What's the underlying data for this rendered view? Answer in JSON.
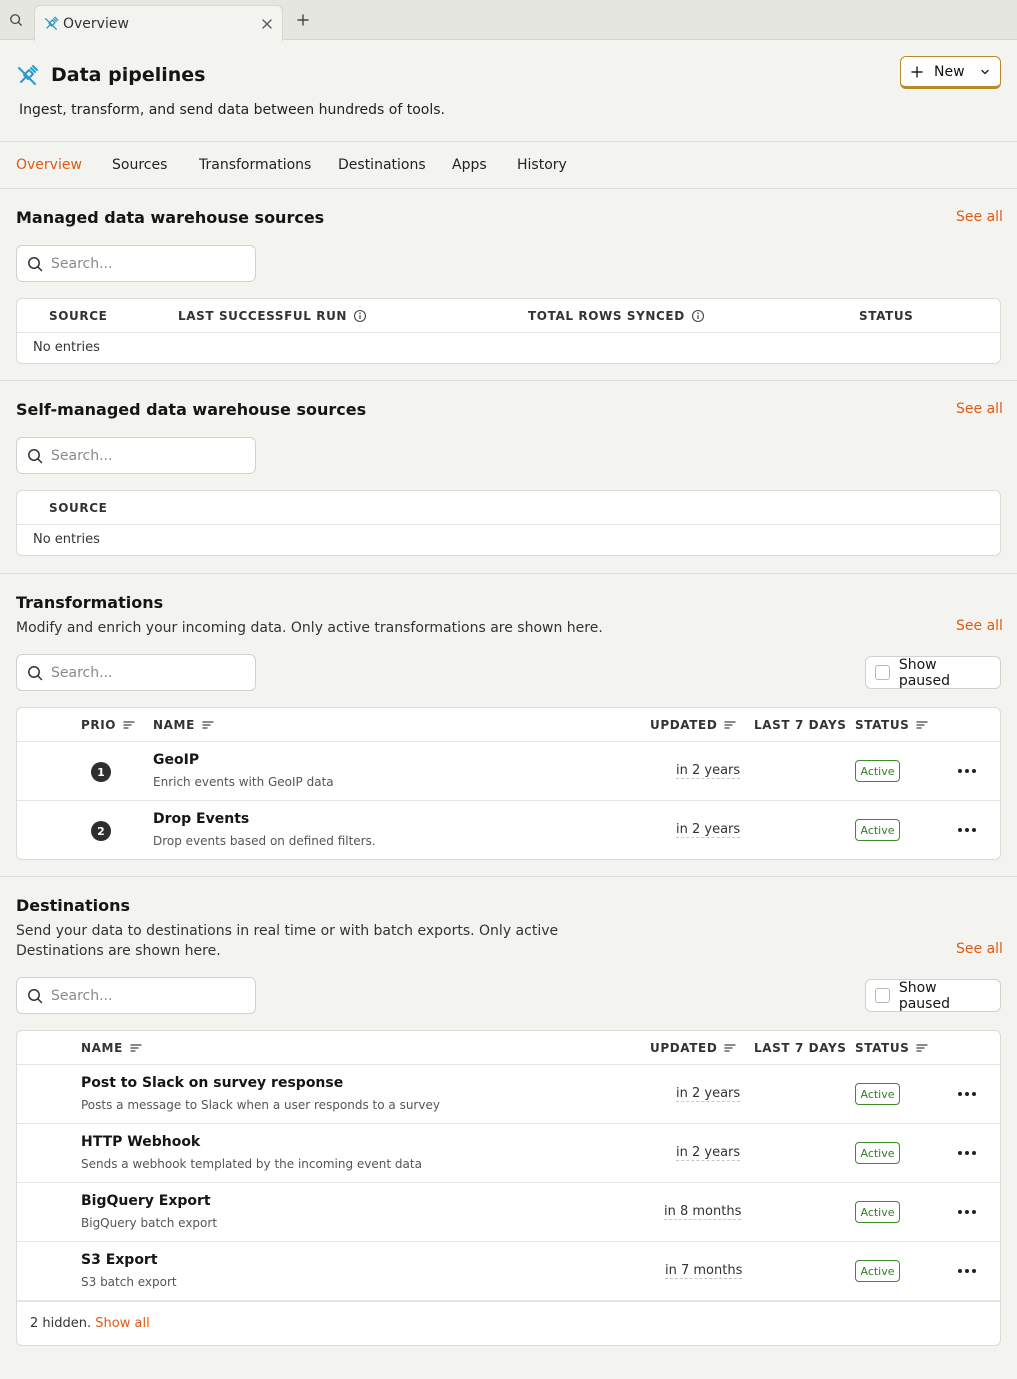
{
  "tabbar": {
    "tab_title": "Overview"
  },
  "header": {
    "title": "Data pipelines",
    "subtitle": "Ingest, transform, and send data between hundreds of tools.",
    "new_label": "New"
  },
  "nav": {
    "tabs": [
      {
        "label": "Overview",
        "active": true
      },
      {
        "label": "Sources"
      },
      {
        "label": "Transformations"
      },
      {
        "label": "Destinations"
      },
      {
        "label": "Apps"
      },
      {
        "label": "History"
      }
    ]
  },
  "colors": {
    "accent": "#e05a12",
    "active_green": "#2f7d21",
    "new_button_border": "#b98a27"
  },
  "managed": {
    "title": "Managed data warehouse sources",
    "see_all": "See all",
    "search_placeholder": "Search...",
    "columns": [
      "SOURCE",
      "LAST SUCCESSFUL RUN",
      "TOTAL ROWS SYNCED",
      "STATUS"
    ],
    "empty": "No entries"
  },
  "selfmanaged": {
    "title": "Self-managed data warehouse sources",
    "see_all": "See all",
    "search_placeholder": "Search...",
    "columns": [
      "SOURCE"
    ],
    "empty": "No entries"
  },
  "transformations": {
    "title": "Transformations",
    "description": "Modify and enrich your incoming data. Only active transformations are shown here.",
    "see_all": "See all",
    "search_placeholder": "Search...",
    "show_paused": "Show paused",
    "columns": [
      "PRIO",
      "NAME",
      "UPDATED",
      "LAST 7 DAYS",
      "STATUS"
    ],
    "rows": [
      {
        "prio": "1",
        "name": "GeoIP",
        "desc": "Enrich events with GeoIP data",
        "updated": "in 2 years",
        "status": "Active"
      },
      {
        "prio": "2",
        "name": "Drop Events",
        "desc": "Drop events based on defined filters.",
        "updated": "in 2 years",
        "status": "Active"
      }
    ]
  },
  "destinations": {
    "title": "Destinations",
    "description_line1": "Send your data to destinations in real time or with batch exports. Only active",
    "description_line2": "Destinations are shown here.",
    "see_all": "See all",
    "search_placeholder": "Search...",
    "show_paused": "Show paused",
    "columns": [
      "NAME",
      "UPDATED",
      "LAST 7 DAYS",
      "STATUS"
    ],
    "rows": [
      {
        "name": "Post to Slack on survey response",
        "desc": "Posts a message to Slack when a user responds to a survey",
        "updated": "in 2 years",
        "status": "Active"
      },
      {
        "name": "HTTP Webhook",
        "desc": "Sends a webhook templated by the incoming event data",
        "updated": "in 2 years",
        "status": "Active"
      },
      {
        "name": "BigQuery Export",
        "desc": "BigQuery batch export",
        "updated": "in 8 months",
        "status": "Active"
      },
      {
        "name": "S3 Export",
        "desc": "S3 batch export",
        "updated": "in 7 months",
        "status": "Active"
      }
    ],
    "footer_hidden": "2 hidden.",
    "footer_show_all": "Show all"
  }
}
